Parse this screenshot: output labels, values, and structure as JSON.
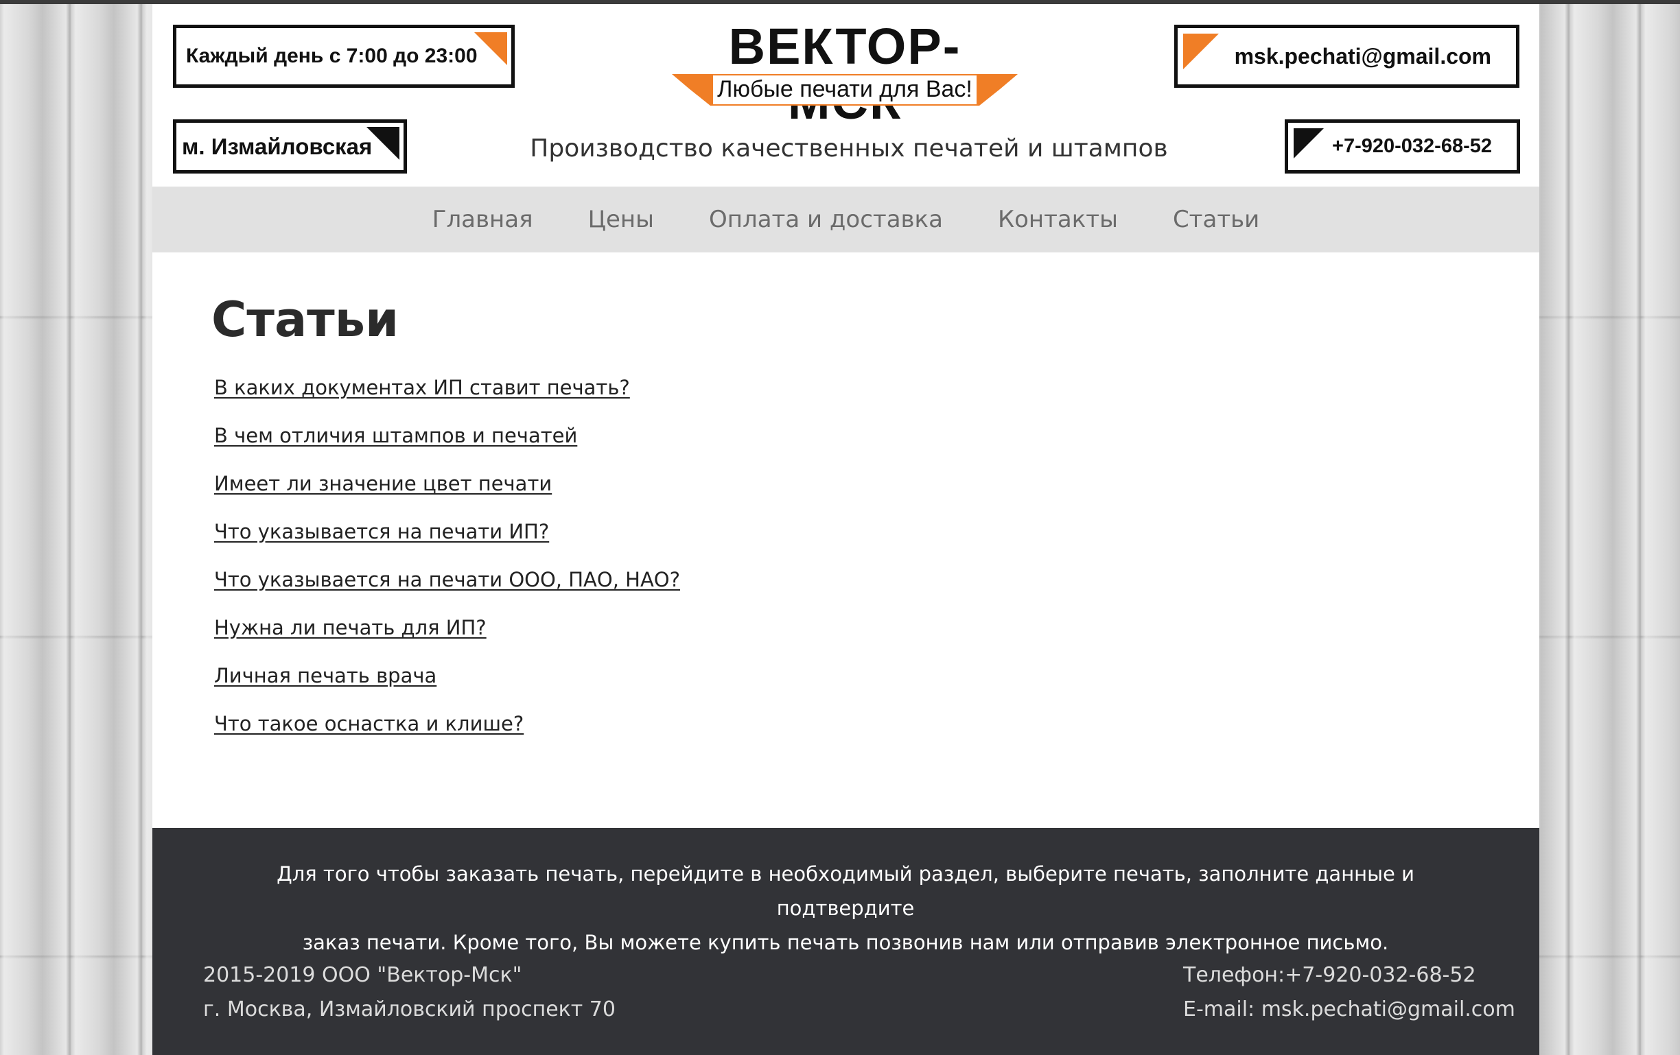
{
  "header": {
    "hours_badge": "Каждый день с 7:00 до 23:00",
    "metro_badge": "м. Измайловская",
    "email_badge": "msk.pechati@gmail.com",
    "phone_badge": "+7-920-032-68-52",
    "logo_title": "ВЕКТОР-МСК",
    "logo_tagline": "Любые печати для Вас!",
    "tagline": "Производство качественных печатей и штампов"
  },
  "nav": {
    "items": [
      {
        "label": "Главная"
      },
      {
        "label": "Цены"
      },
      {
        "label": "Оплата и доставка"
      },
      {
        "label": "Контакты"
      },
      {
        "label": "Статьи"
      }
    ]
  },
  "main": {
    "title": "Статьи",
    "articles": [
      {
        "title": "В каких документах ИП ставит печать?"
      },
      {
        "title": "В чем отличия штампов и печатей"
      },
      {
        "title": "Имеет ли значение цвет печати"
      },
      {
        "title": "Что указывается на печати ИП?"
      },
      {
        "title": "Что указывается на печати ООО, ПАО, НАО?"
      },
      {
        "title": "Нужна ли печать для ИП?"
      },
      {
        "title": "Личная печать врача"
      },
      {
        "title": "Что такое оснастка и клише?"
      }
    ]
  },
  "footer": {
    "note_line1": "Для того чтобы заказать печать, перейдите в необходимый раздел, выберите печать, заполните данные и подтвердите",
    "note_line2": "заказ печати. Кроме того, Вы можете купить печать позвонив нам или отправив электронное письмо.",
    "copyright": "2015-2019 ООО \"Вектор-Мск\"",
    "address": "г. Москва, Измайловский проспект 70",
    "phone": "Телефон:+7-920-032-68-52",
    "email": "E-mail: msk.pechati@gmail.com"
  },
  "colors": {
    "accent": "#f07e26",
    "nav_bg": "#e1e1e1",
    "footer_bg": "#323337"
  }
}
